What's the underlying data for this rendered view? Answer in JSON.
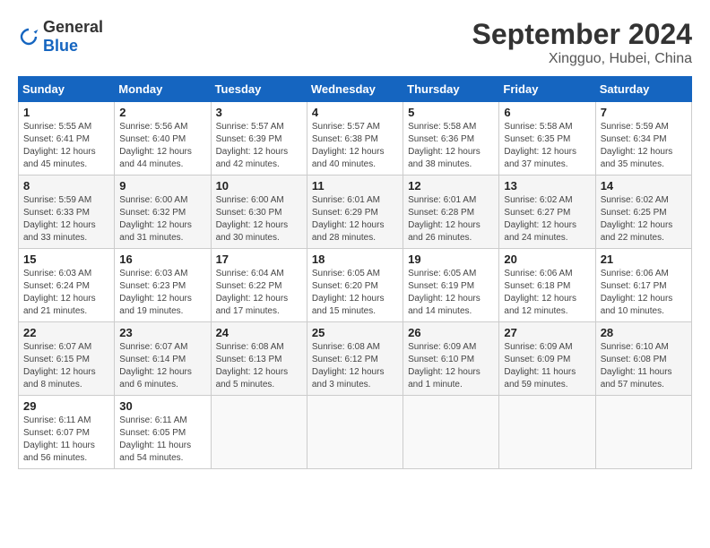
{
  "header": {
    "logo_general": "General",
    "logo_blue": "Blue",
    "month_title": "September 2024",
    "subtitle": "Xingguo, Hubei, China"
  },
  "calendar": {
    "days_of_week": [
      "Sunday",
      "Monday",
      "Tuesday",
      "Wednesday",
      "Thursday",
      "Friday",
      "Saturday"
    ],
    "weeks": [
      [
        null,
        null,
        null,
        null,
        {
          "day": 5,
          "sunrise": "5:58 AM",
          "sunset": "6:36 PM",
          "daylight": "12 hours and 38 minutes."
        },
        {
          "day": 6,
          "sunrise": "5:58 AM",
          "sunset": "6:35 PM",
          "daylight": "12 hours and 37 minutes."
        },
        {
          "day": 7,
          "sunrise": "5:59 AM",
          "sunset": "6:34 PM",
          "daylight": "12 hours and 35 minutes."
        }
      ],
      [
        {
          "day": 1,
          "sunrise": "5:55 AM",
          "sunset": "6:41 PM",
          "daylight": "12 hours and 45 minutes."
        },
        {
          "day": 2,
          "sunrise": "5:56 AM",
          "sunset": "6:40 PM",
          "daylight": "12 hours and 44 minutes."
        },
        {
          "day": 3,
          "sunrise": "5:57 AM",
          "sunset": "6:39 PM",
          "daylight": "12 hours and 42 minutes."
        },
        {
          "day": 4,
          "sunrise": "5:57 AM",
          "sunset": "6:38 PM",
          "daylight": "12 hours and 40 minutes."
        },
        {
          "day": 5,
          "sunrise": "5:58 AM",
          "sunset": "6:36 PM",
          "daylight": "12 hours and 38 minutes."
        },
        {
          "day": 6,
          "sunrise": "5:58 AM",
          "sunset": "6:35 PM",
          "daylight": "12 hours and 37 minutes."
        },
        {
          "day": 7,
          "sunrise": "5:59 AM",
          "sunset": "6:34 PM",
          "daylight": "12 hours and 35 minutes."
        }
      ],
      [
        {
          "day": 8,
          "sunrise": "5:59 AM",
          "sunset": "6:33 PM",
          "daylight": "12 hours and 33 minutes."
        },
        {
          "day": 9,
          "sunrise": "6:00 AM",
          "sunset": "6:32 PM",
          "daylight": "12 hours and 31 minutes."
        },
        {
          "day": 10,
          "sunrise": "6:00 AM",
          "sunset": "6:30 PM",
          "daylight": "12 hours and 30 minutes."
        },
        {
          "day": 11,
          "sunrise": "6:01 AM",
          "sunset": "6:29 PM",
          "daylight": "12 hours and 28 minutes."
        },
        {
          "day": 12,
          "sunrise": "6:01 AM",
          "sunset": "6:28 PM",
          "daylight": "12 hours and 26 minutes."
        },
        {
          "day": 13,
          "sunrise": "6:02 AM",
          "sunset": "6:27 PM",
          "daylight": "12 hours and 24 minutes."
        },
        {
          "day": 14,
          "sunrise": "6:02 AM",
          "sunset": "6:25 PM",
          "daylight": "12 hours and 22 minutes."
        }
      ],
      [
        {
          "day": 15,
          "sunrise": "6:03 AM",
          "sunset": "6:24 PM",
          "daylight": "12 hours and 21 minutes."
        },
        {
          "day": 16,
          "sunrise": "6:03 AM",
          "sunset": "6:23 PM",
          "daylight": "12 hours and 19 minutes."
        },
        {
          "day": 17,
          "sunrise": "6:04 AM",
          "sunset": "6:22 PM",
          "daylight": "12 hours and 17 minutes."
        },
        {
          "day": 18,
          "sunrise": "6:05 AM",
          "sunset": "6:20 PM",
          "daylight": "12 hours and 15 minutes."
        },
        {
          "day": 19,
          "sunrise": "6:05 AM",
          "sunset": "6:19 PM",
          "daylight": "12 hours and 14 minutes."
        },
        {
          "day": 20,
          "sunrise": "6:06 AM",
          "sunset": "6:18 PM",
          "daylight": "12 hours and 12 minutes."
        },
        {
          "day": 21,
          "sunrise": "6:06 AM",
          "sunset": "6:17 PM",
          "daylight": "12 hours and 10 minutes."
        }
      ],
      [
        {
          "day": 22,
          "sunrise": "6:07 AM",
          "sunset": "6:15 PM",
          "daylight": "12 hours and 8 minutes."
        },
        {
          "day": 23,
          "sunrise": "6:07 AM",
          "sunset": "6:14 PM",
          "daylight": "12 hours and 6 minutes."
        },
        {
          "day": 24,
          "sunrise": "6:08 AM",
          "sunset": "6:13 PM",
          "daylight": "12 hours and 5 minutes."
        },
        {
          "day": 25,
          "sunrise": "6:08 AM",
          "sunset": "6:12 PM",
          "daylight": "12 hours and 3 minutes."
        },
        {
          "day": 26,
          "sunrise": "6:09 AM",
          "sunset": "6:10 PM",
          "daylight": "12 hours and 1 minute."
        },
        {
          "day": 27,
          "sunrise": "6:09 AM",
          "sunset": "6:09 PM",
          "daylight": "11 hours and 59 minutes."
        },
        {
          "day": 28,
          "sunrise": "6:10 AM",
          "sunset": "6:08 PM",
          "daylight": "11 hours and 57 minutes."
        }
      ],
      [
        {
          "day": 29,
          "sunrise": "6:11 AM",
          "sunset": "6:07 PM",
          "daylight": "11 hours and 56 minutes."
        },
        {
          "day": 30,
          "sunrise": "6:11 AM",
          "sunset": "6:05 PM",
          "daylight": "11 hours and 54 minutes."
        },
        null,
        null,
        null,
        null,
        null
      ]
    ]
  }
}
